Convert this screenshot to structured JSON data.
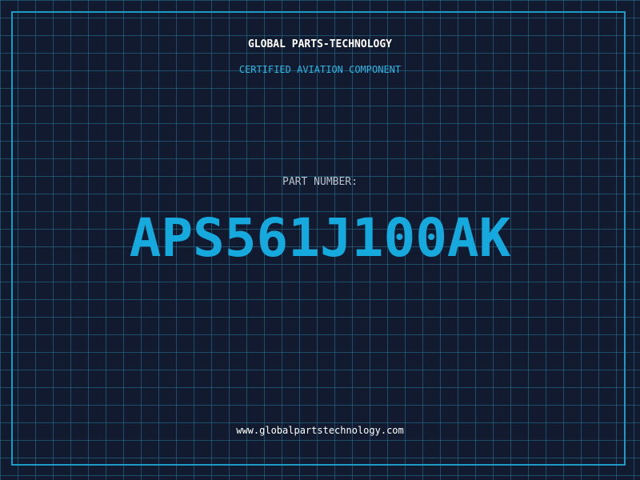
{
  "header": {
    "company": "GLOBAL PARTS-TECHNOLOGY",
    "subtitle": "CERTIFIED AVIATION COMPONENT"
  },
  "part": {
    "label": "PART NUMBER:",
    "number": "APS561J100AK"
  },
  "footer": {
    "website": "www.globalpartstechnology.com"
  },
  "colors": {
    "background": "#111a2e",
    "grid": "#287896",
    "frame": "#1e9bc4",
    "accent": "#16a9dd",
    "subtitle": "#2ab7e6"
  }
}
